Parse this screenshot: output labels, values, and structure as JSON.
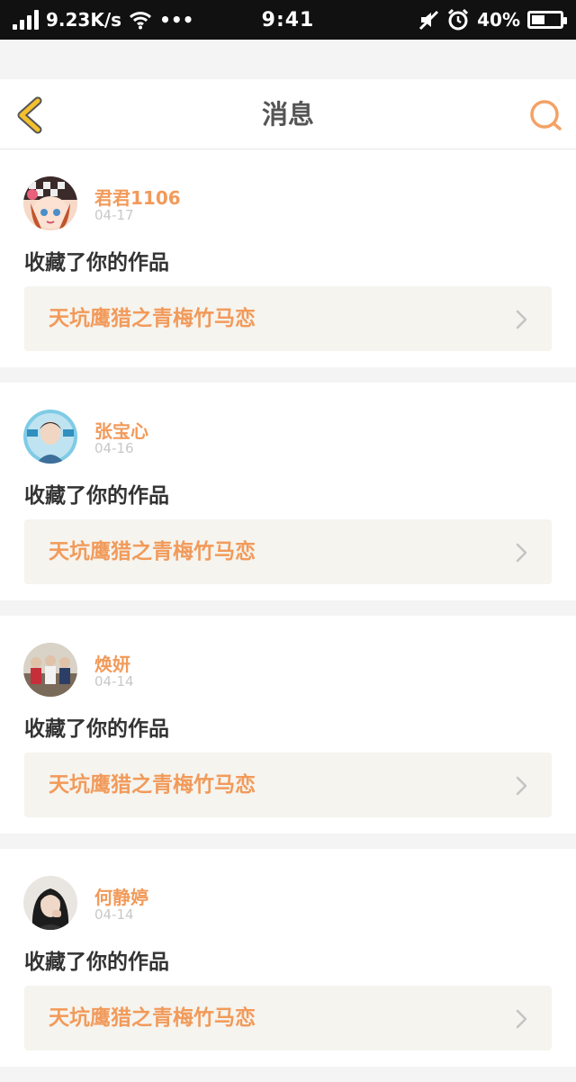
{
  "status_bar": {
    "speed": "9.23K/s",
    "dots": "•••",
    "time": "9:41",
    "battery": "40%",
    "battery_level": 0.4
  },
  "header": {
    "title": "消息"
  },
  "colors": {
    "accent": "#f29a5a",
    "back": "#f3c02f"
  },
  "messages": [
    {
      "user": "君君1106",
      "date": "04-17",
      "action": "收藏了你的作品",
      "work": "天坑鹰猎之青梅竹马恋"
    },
    {
      "user": "张宝心",
      "date": "04-16",
      "action": "收藏了你的作品",
      "work": "天坑鹰猎之青梅竹马恋"
    },
    {
      "user": "焕妍",
      "date": "04-14",
      "action": "收藏了你的作品",
      "work": "天坑鹰猎之青梅竹马恋"
    },
    {
      "user": "何静婷",
      "date": "04-14",
      "action": "收藏了你的作品",
      "work": "天坑鹰猎之青梅竹马恋"
    }
  ]
}
